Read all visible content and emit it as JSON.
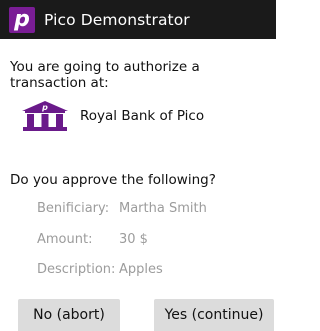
{
  "header": {
    "logo_letter": "p",
    "title": "Pico Demonstrator",
    "logo_color": "#7a1d95",
    "bar_color": "#1a1a1a"
  },
  "intro": {
    "text": "You are going to authorize a transaction at:"
  },
  "bank": {
    "icon": "bank-building-icon",
    "icon_letter": "p",
    "name": "Royal Bank of Pico",
    "icon_color": "#6a1a8a"
  },
  "approval": {
    "question": "Do you approve the following?",
    "details": [
      {
        "label": "Benificiary:",
        "value": "Martha Smith"
      },
      {
        "label": "Amount:",
        "value": "30 $"
      },
      {
        "label": "Description:",
        "value": "Apples"
      }
    ]
  },
  "actions": {
    "abort_label": "No (abort)",
    "continue_label": "Yes (continue)"
  }
}
